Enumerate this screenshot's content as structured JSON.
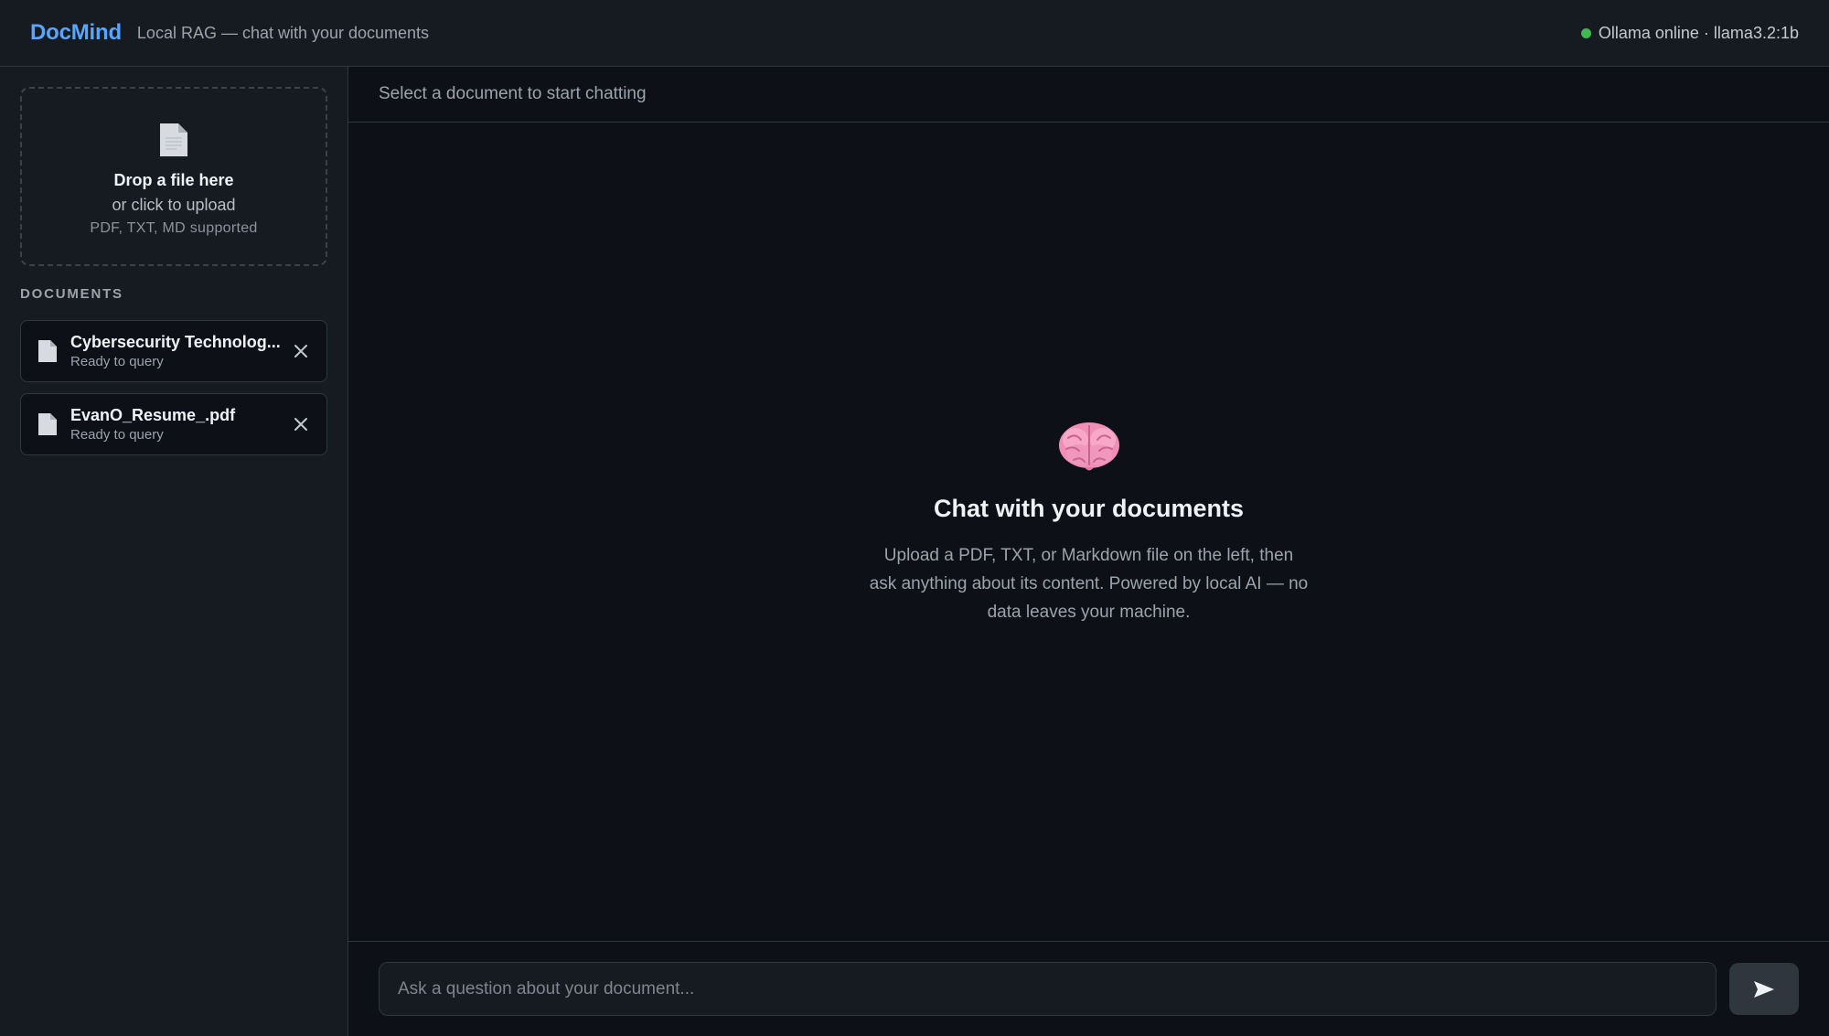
{
  "header": {
    "logo": "DocMind",
    "tagline": "Local RAG — chat with your documents",
    "status_text": "Ollama online · llama3.2:1b",
    "status_color": "#3fb950"
  },
  "sidebar": {
    "dropzone": {
      "icon": "document-icon",
      "title": "Drop a file here",
      "subtitle": "or click to upload",
      "formats": "PDF, TXT, MD supported"
    },
    "documents_heading": "DOCUMENTS",
    "documents": [
      {
        "name": "Cybersecurity Technolog...",
        "status": "Ready to query"
      },
      {
        "name": "EvanO_Resume_.pdf",
        "status": "Ready to query"
      }
    ]
  },
  "main": {
    "header_text": "Select a document to start chatting",
    "empty_state": {
      "icon": "brain-icon",
      "title": "Chat with your documents",
      "description": "Upload a PDF, TXT, or Markdown file on the left, then ask anything about its content. Powered by local AI — no data leaves your machine."
    },
    "input": {
      "placeholder": "Ask a question about your document...",
      "value": ""
    },
    "send_icon": "send-icon"
  },
  "colors": {
    "accent": "#58a6ff",
    "background": "#0d1117",
    "panel": "#161b22",
    "border": "#30363d"
  }
}
